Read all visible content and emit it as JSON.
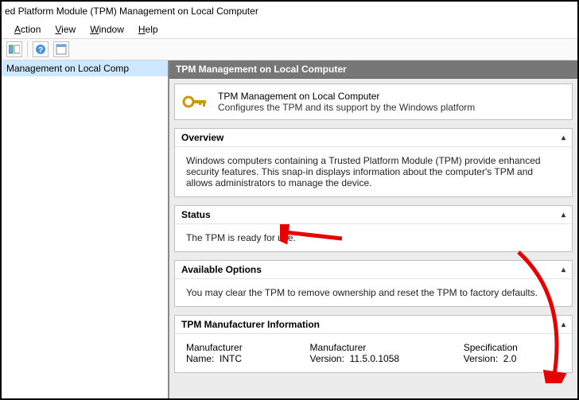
{
  "title": "ed Platform Module (TPM) Management on Local Computer",
  "menu": {
    "action": "Action",
    "view": "View",
    "window": "Window",
    "help": "Help"
  },
  "tree": {
    "selected": "Management on Local Comp"
  },
  "header": "TPM Management on Local Computer",
  "summary": {
    "title": "TPM Management on Local Computer",
    "desc": "Configures the TPM and its support by the Windows platform"
  },
  "overview": {
    "title": "Overview",
    "body": "Windows computers containing a Trusted Platform Module (TPM) provide enhanced security features. This snap-in displays information about the computer's TPM and allows administrators to manage the device."
  },
  "status": {
    "title": "Status",
    "body": "The TPM is ready for use."
  },
  "options": {
    "title": "Available Options",
    "body": "You may clear the TPM to remove ownership and reset the TPM to factory defaults."
  },
  "mfr": {
    "title": "TPM Manufacturer Information",
    "name_label": "Manufacturer Name:",
    "name_value": "INTC",
    "ver_label": "Manufacturer Version:",
    "ver_value": "11.5.0.1058",
    "spec_label": "Specification Version:",
    "spec_value": "2.0"
  }
}
